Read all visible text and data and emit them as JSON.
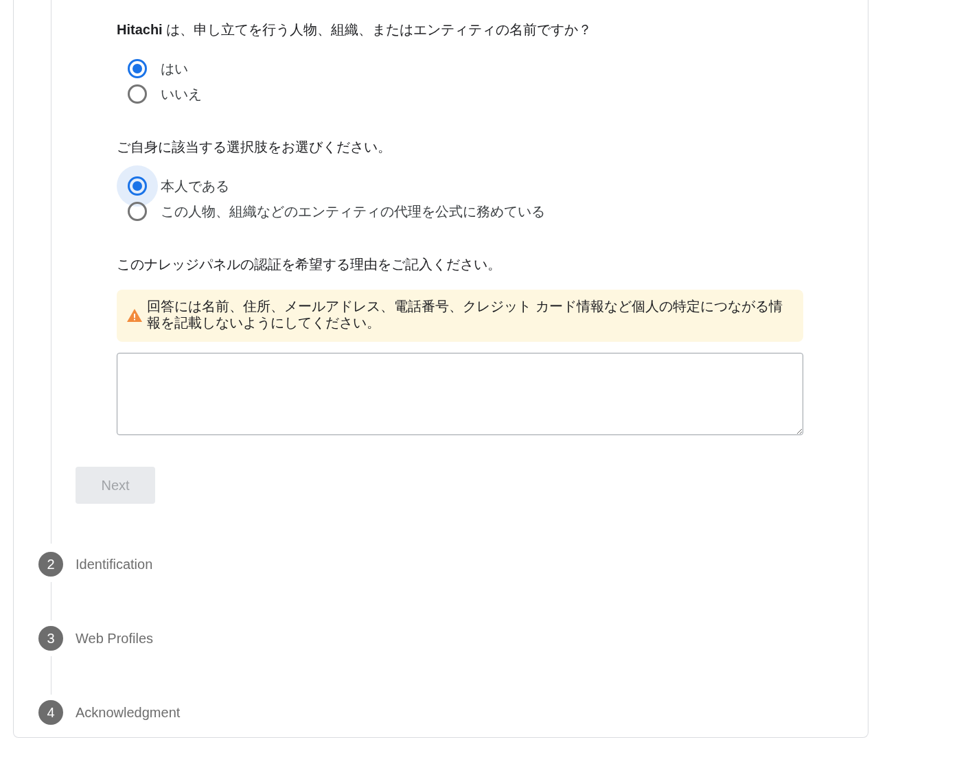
{
  "questions": [
    {
      "text": "**Hitachi** は、申し立てを行う人物、組織、またはエンティティの名前ですか？",
      "options": [
        {
          "label": "はい",
          "selected": true,
          "focused": false
        },
        {
          "label": "いいえ",
          "selected": false,
          "focused": false
        }
      ]
    },
    {
      "text": "ご自身に該当する選択肢をお選びください。",
      "options": [
        {
          "label": "本人である",
          "selected": true,
          "focused": true
        },
        {
          "label": "この人物、組織などのエンティティの代理を公式に務めている",
          "selected": false,
          "focused": false
        }
      ]
    }
  ],
  "reason": {
    "text": "このナレッジパネルの認証を希望する理由をご記入ください。",
    "warning": "回答には名前、住所、メールアドレス、電話番号、クレジット カード情報など個人の特定につながる情報を記載しないようにしてください。"
  },
  "next_button": {
    "label": "Next",
    "disabled": true
  },
  "steps": [
    {
      "number": "2",
      "label": "Identification"
    },
    {
      "number": "3",
      "label": "Web Profiles"
    },
    {
      "number": "4",
      "label": "Acknowledgment"
    }
  ]
}
